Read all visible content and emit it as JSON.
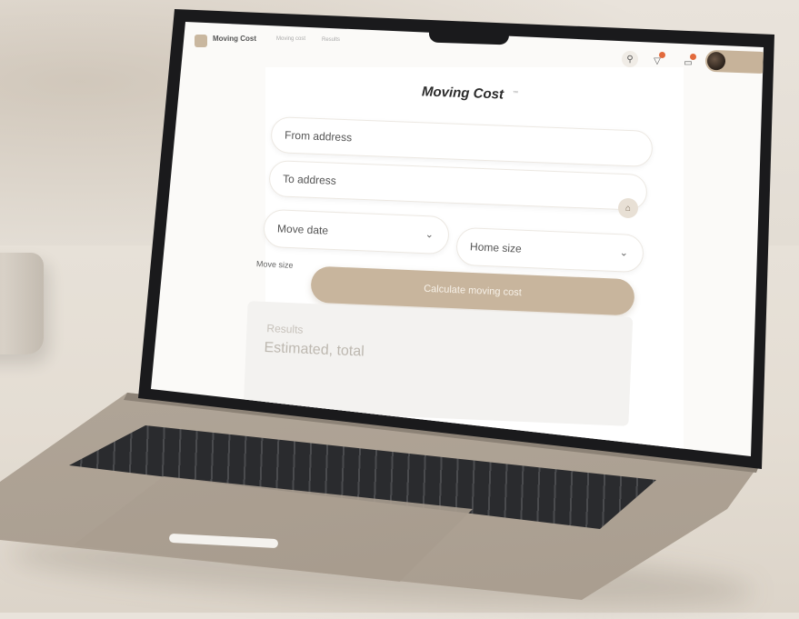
{
  "app": {
    "name": "Moving Cost",
    "nav": [
      "Moving cost",
      "Results"
    ]
  },
  "page": {
    "title": "Moving Cost",
    "title_mark": "™"
  },
  "form": {
    "from_placeholder": "From address",
    "to_placeholder": "To address",
    "date_label": "Move date",
    "size_label": "Home size",
    "move_size_label": "Move size",
    "submit_label": "Calculate moving cost"
  },
  "results": {
    "label": "Results",
    "value_label": "Estimated, total"
  },
  "colors": {
    "accent": "#c8b59d",
    "notification": "#e26a3c"
  },
  "icons": {
    "search": "search-icon",
    "notifications": "bell-icon",
    "messages": "message-icon",
    "home": "home-icon",
    "chevron": "chevron-down-icon"
  }
}
